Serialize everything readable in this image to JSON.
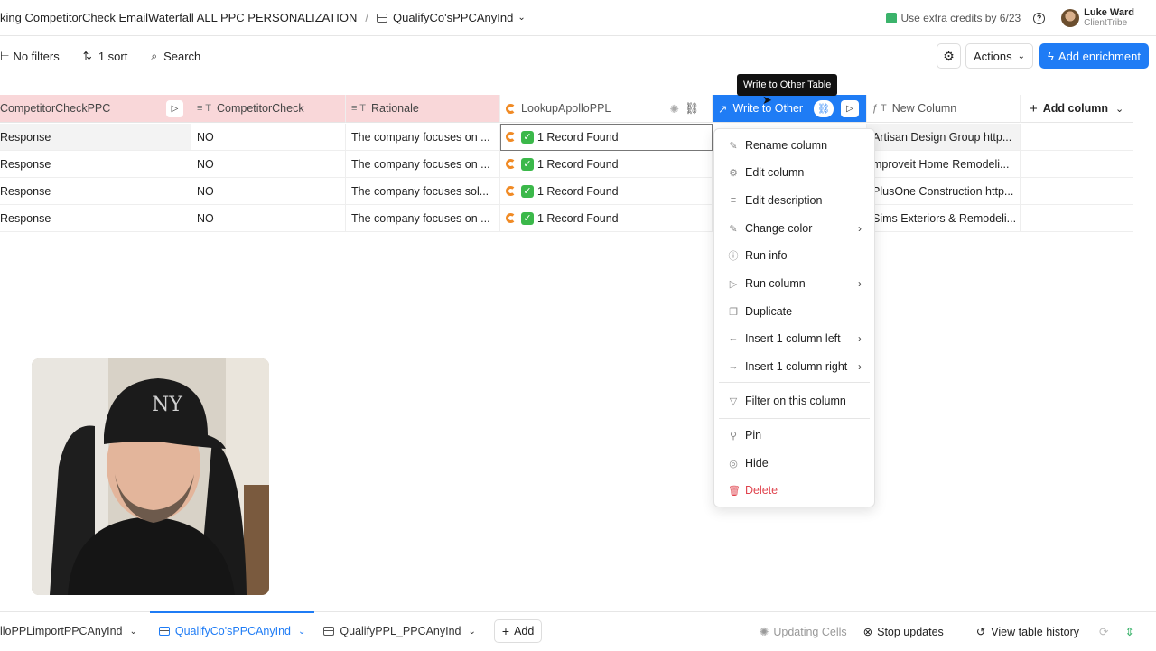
{
  "breadcrumb": {
    "workbook": "king CompetitorCheck EmailWaterfall ALL PPC PERSONALIZATION",
    "separator": "/",
    "table": "QualifyCo'sPPCAnyInd"
  },
  "top_right": {
    "credits": "Use extra credits by 6/23",
    "user_name": "Luke Ward",
    "user_org": "ClientTribe"
  },
  "toolbar": {
    "filters": "No filters",
    "sort": "1 sort",
    "search": "Search",
    "actions": "Actions",
    "add_enrichment": "Add enrichment"
  },
  "columns": [
    {
      "label": "CompetitorCheckPPC"
    },
    {
      "label": "CompetitorCheck"
    },
    {
      "label": "Rationale"
    },
    {
      "label": "LookupApolloPPL"
    },
    {
      "label": "Write to Other"
    },
    {
      "label": "New Column"
    },
    {
      "label": "Add column"
    }
  ],
  "rows": [
    {
      "c1": "Response",
      "c2": "NO",
      "c3": "The company focuses on ...",
      "c4": "1 Record Found",
      "c6": "Artisan Design Group http..."
    },
    {
      "c1": "Response",
      "c2": "NO",
      "c3": "The company focuses on ...",
      "c4": "1 Record Found",
      "c6": "mproveit Home Remodeli..."
    },
    {
      "c1": "Response",
      "c2": "NO",
      "c3": "The company focuses sol...",
      "c4": "1 Record Found",
      "c6": "PlusOne Construction http..."
    },
    {
      "c1": "Response",
      "c2": "NO",
      "c3": "The company focuses on ...",
      "c4": "1 Record Found",
      "c6": "Sims Exteriors & Remodeli..."
    }
  ],
  "tooltip": "Write to Other Table",
  "context_menu": {
    "items": [
      {
        "label": "Rename column",
        "icon": "pencil-icon",
        "glyph": "✎"
      },
      {
        "label": "Edit column",
        "icon": "gear-icon",
        "glyph": "⚙"
      },
      {
        "label": "Edit description",
        "icon": "text-icon",
        "glyph": "≡"
      },
      {
        "label": "Change color",
        "icon": "brush-icon",
        "glyph": "✎",
        "submenu": true
      },
      {
        "label": "Run info",
        "icon": "info-icon",
        "glyph": "ⓘ"
      },
      {
        "label": "Run column",
        "icon": "play-icon",
        "glyph": "▷",
        "submenu": true
      },
      {
        "label": "Duplicate",
        "icon": "copy-icon",
        "glyph": "❐"
      },
      {
        "label": "Insert 1 column left",
        "icon": "arrow-left-icon",
        "glyph": "←",
        "submenu": true
      },
      {
        "label": "Insert 1 column right",
        "icon": "arrow-right-icon",
        "glyph": "→",
        "submenu": true
      },
      {
        "label": "Filter on this column",
        "icon": "filter-icon",
        "glyph": "▽"
      },
      {
        "label": "Pin",
        "icon": "pin-icon",
        "glyph": "⚲"
      },
      {
        "label": "Hide",
        "icon": "eye-off-icon",
        "glyph": "◎"
      },
      {
        "label": "Delete",
        "icon": "trash-icon",
        "glyph": "🗑"
      }
    ]
  },
  "bottom": {
    "tabs": [
      {
        "label": "lloPPLimportPPCAnyInd"
      },
      {
        "label": "QualifyCo'sPPCAnyInd"
      },
      {
        "label": "QualifyPPL_PPCAnyInd"
      }
    ],
    "add": "Add",
    "updating": "Updating Cells",
    "stop": "Stop updates",
    "history": "View table history"
  },
  "colors": {
    "accent": "#1f7cf5",
    "pink_header": "#f9d7d9",
    "delete": "#e0454f"
  }
}
